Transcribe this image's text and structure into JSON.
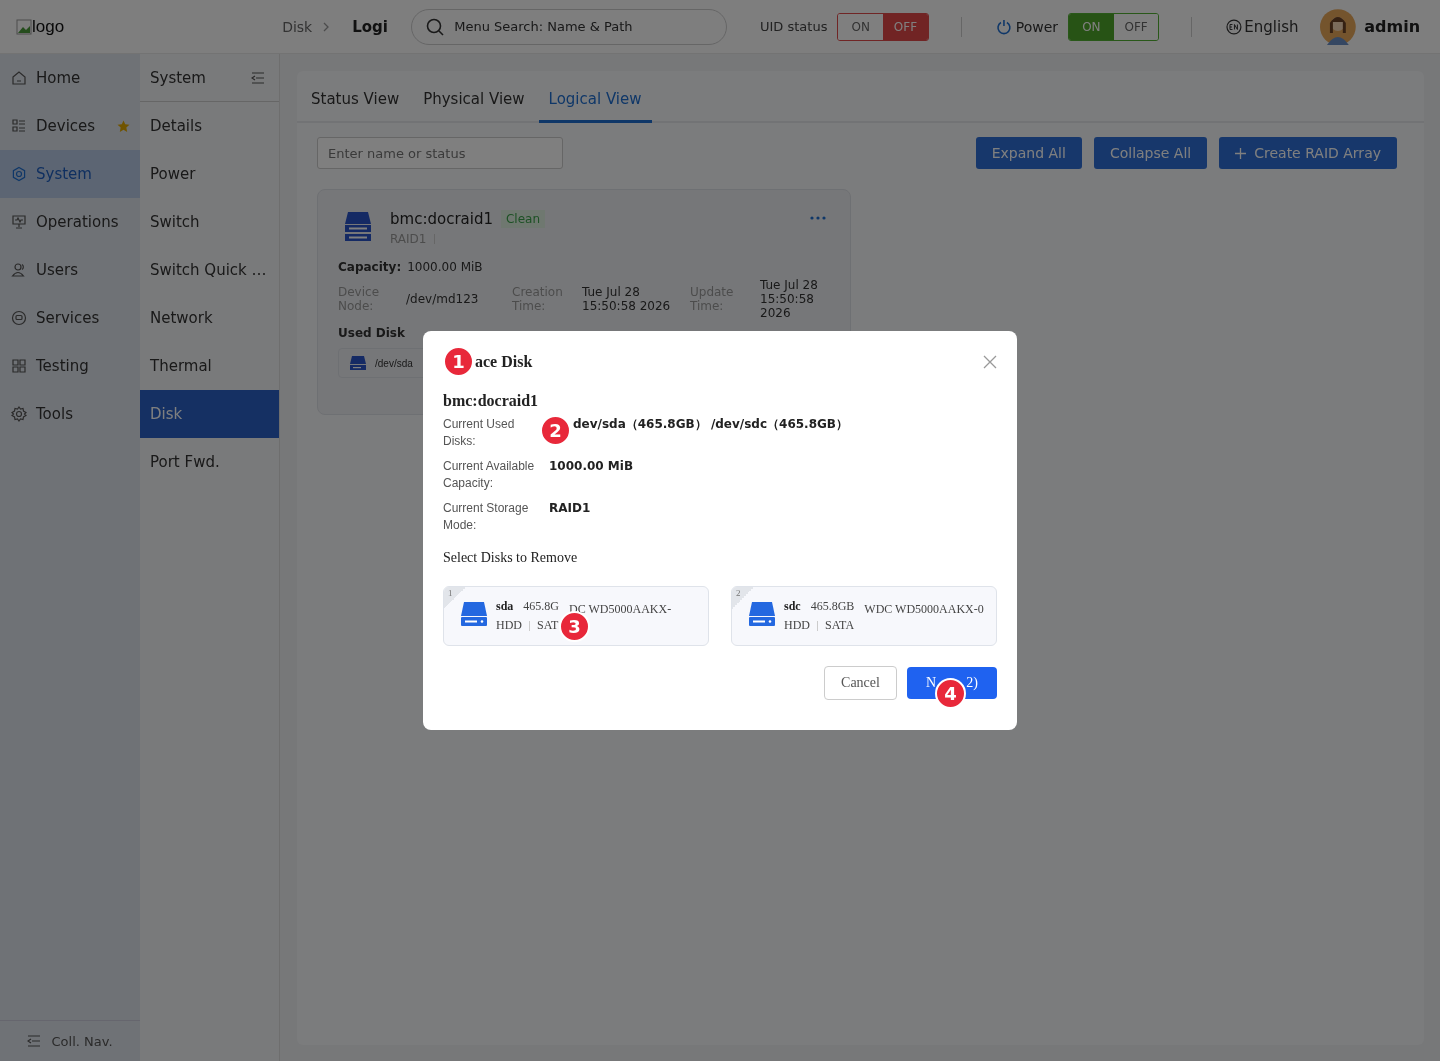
{
  "header": {
    "logo_alt": "logo",
    "breadcrumb": [
      "Disk",
      "Logi"
    ],
    "search": {
      "placeholder": "Menu Search: Name & Path"
    },
    "uid_status": {
      "label": "UID status",
      "options": [
        {
          "label": "ON",
          "selected": false
        },
        {
          "label": "OFF",
          "selected": true
        }
      ]
    },
    "power": {
      "label": "Power",
      "options": [
        {
          "label": "ON",
          "selected": true
        },
        {
          "label": "OFF",
          "selected": false
        }
      ]
    },
    "language": "English",
    "user": "admin"
  },
  "nav": {
    "items": [
      {
        "label": "Home",
        "selected": false,
        "starred": false
      },
      {
        "label": "Devices",
        "selected": false,
        "starred": true
      },
      {
        "label": "System",
        "selected": true,
        "starred": false
      },
      {
        "label": "Operations",
        "selected": false,
        "starred": false
      },
      {
        "label": "Users",
        "selected": false,
        "starred": false
      },
      {
        "label": "Services",
        "selected": false,
        "starred": false
      },
      {
        "label": "Testing",
        "selected": false,
        "starred": false
      },
      {
        "label": "Tools",
        "selected": false,
        "starred": false
      }
    ],
    "collapse": "Coll. Nav."
  },
  "subnav": {
    "title": "System",
    "items": [
      {
        "label": "Details",
        "selected": false
      },
      {
        "label": "Power",
        "selected": false
      },
      {
        "label": "Switch",
        "selected": false
      },
      {
        "label": "Switch Quick …",
        "selected": false
      },
      {
        "label": "Network",
        "selected": false
      },
      {
        "label": "Thermal",
        "selected": false
      },
      {
        "label": "Disk",
        "selected": true
      },
      {
        "label": "Port Fwd.",
        "selected": false
      }
    ]
  },
  "tabs": [
    {
      "label": "Status View",
      "selected": false
    },
    {
      "label": "Physical View",
      "selected": false
    },
    {
      "label": "Logical View",
      "selected": true
    }
  ],
  "filter": {
    "placeholder": "Enter name or status"
  },
  "actions": [
    "Expand All",
    "Collapse All",
    "Create RAID Array"
  ],
  "raid_card": {
    "name": "bmc:docraid1",
    "status": "Clean",
    "level": "RAID1",
    "capacity_label": "Capacity:",
    "capacity": "1000.00 MiB",
    "fields": [
      {
        "label": "Device Node:",
        "value": "/dev/md123"
      },
      {
        "label": "Creation Time:",
        "value": "Tue Jul 28 15:50:58 2026"
      },
      {
        "label": "Update Time:",
        "value": "Tue Jul 28 15:50:58 2026"
      }
    ],
    "used_disk_label": "Used Disk",
    "used_disks": [
      "/dev/sda"
    ]
  },
  "dialog": {
    "title": "ace Disk",
    "array": "bmc:docraid1",
    "info": [
      {
        "label": "Current Used Disks:",
        "value": "dev/sda（465.8GB） /dev/sdc（465.8GB）"
      },
      {
        "label": "Current Available Capacity:",
        "value": "1000.00 MiB"
      },
      {
        "label": "Current Storage Mode:",
        "value": "RAID1"
      }
    ],
    "section": "Select Disks to Remove",
    "disks": [
      {
        "index": "1",
        "name": "sda",
        "size": "465.8G",
        "model": "DC WD5000AAKX-",
        "type": "HDD",
        "interface": "SAT"
      },
      {
        "index": "2",
        "name": "sdc",
        "size": "465.8GB",
        "model": "WDC WD5000AAKX-0",
        "type": "HDD",
        "interface": "SATA"
      }
    ],
    "cancel": "Cancel",
    "next_start": "N",
    "next_end": "2)"
  },
  "annotations": [
    {
      "number": "1"
    },
    {
      "number": "2"
    },
    {
      "number": "3"
    },
    {
      "number": "4"
    }
  ]
}
